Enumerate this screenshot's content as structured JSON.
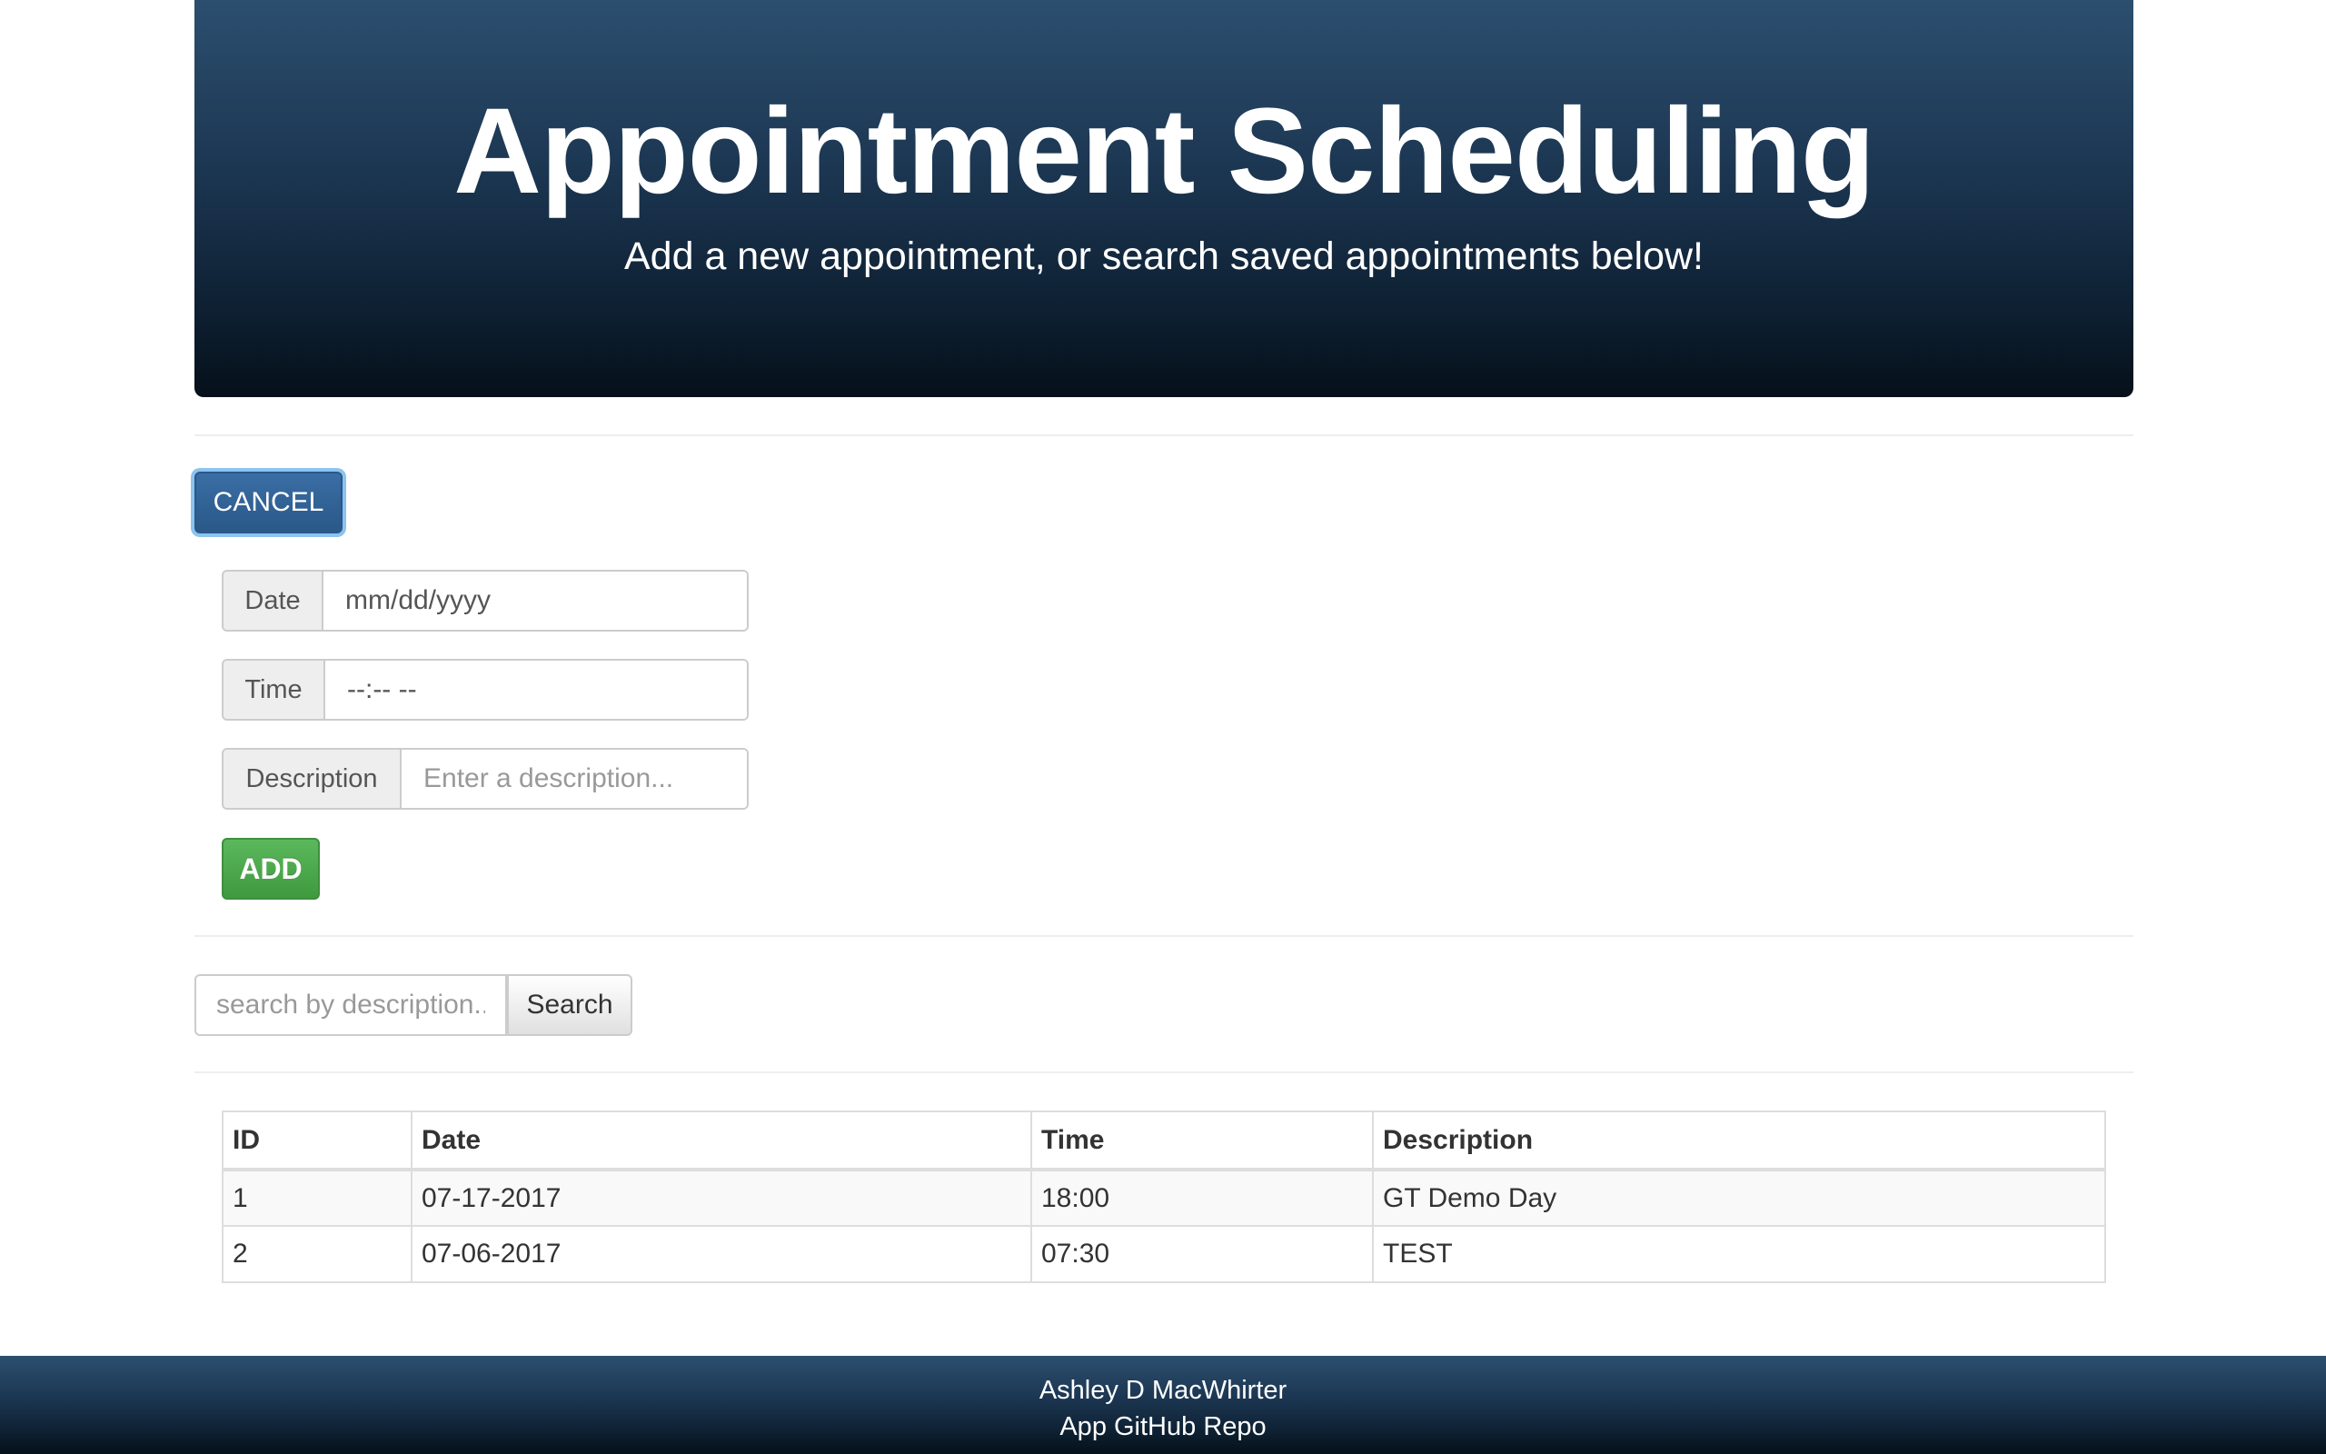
{
  "header": {
    "title": "Appointment Scheduling",
    "subtitle": "Add a new appointment, or search saved appointments below!"
  },
  "form": {
    "cancel_label": "CANCEL",
    "date": {
      "label": "Date",
      "value": "mm/dd/yyyy"
    },
    "time": {
      "label": "Time",
      "value": "--:-- --"
    },
    "description": {
      "label": "Description",
      "placeholder": "Enter a description..."
    },
    "add_label": "ADD"
  },
  "search": {
    "placeholder": "search by description...",
    "button_label": "Search"
  },
  "table": {
    "columns": [
      "ID",
      "Date",
      "Time",
      "Description"
    ],
    "rows": [
      [
        "1",
        "07-17-2017",
        "18:00",
        "GT Demo Day"
      ],
      [
        "2",
        "07-06-2017",
        "07:30",
        "TEST"
      ]
    ]
  },
  "footer": {
    "author": "Ashley D MacWhirter",
    "repo_link": "App GitHub Repo"
  },
  "colors": {
    "primary": "#2a5888",
    "success": "#5cb85c",
    "header_dark": "#05101a"
  }
}
